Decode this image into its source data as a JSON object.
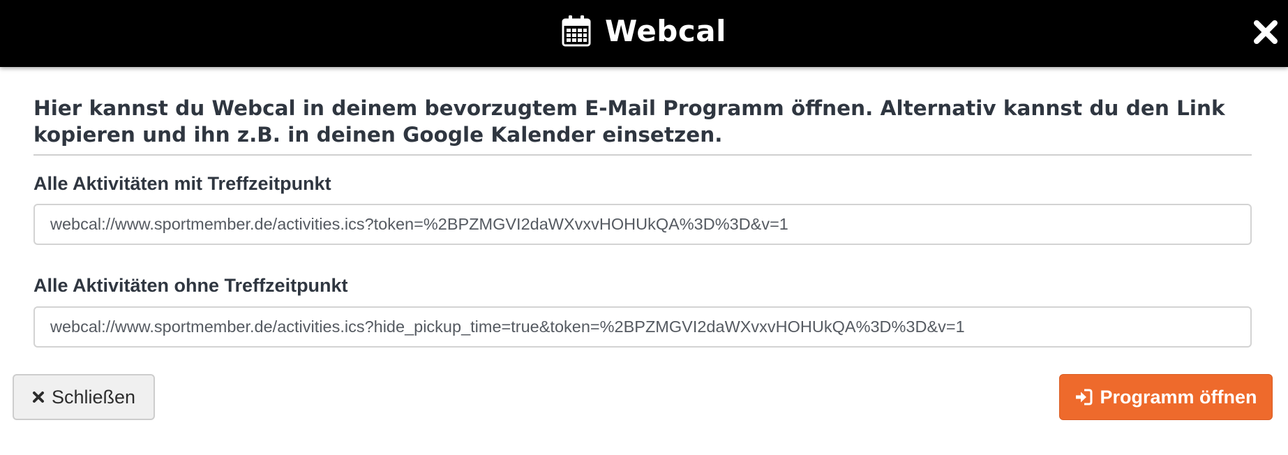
{
  "header": {
    "title": "Webcal",
    "icon": "calendar-icon",
    "close_icon": "close-icon"
  },
  "intro": {
    "text": "Hier kannst du Webcal in deinem bevorzugtem E-Mail Programm öffnen. Alternativ kannst du den Link kopieren und ihn z.B. in deinen Google Kalender einsetzen."
  },
  "fields": [
    {
      "label": "Alle Aktivitäten mit Treffzeitpunkt",
      "value": "webcal://www.sportmember.de/activities.ics?token=%2BPZMGVI2daWXvxvHOHUkQA%3D%3D&v=1"
    },
    {
      "label": "Alle Aktivitäten ohne Treffzeitpunkt",
      "value": "webcal://www.sportmember.de/activities.ics?hide_pickup_time=true&token=%2BPZMGVI2daWXvxvHOHUkQA%3D%3D&v=1"
    }
  ],
  "buttons": {
    "close_label": "Schließen",
    "close_icon": "times-icon",
    "open_label": "Programm öffnen",
    "open_icon": "sign-in-icon"
  },
  "colors": {
    "header_bg": "#000000",
    "primary_button": "#ee6a2c",
    "heading_text": "#2f3640"
  }
}
